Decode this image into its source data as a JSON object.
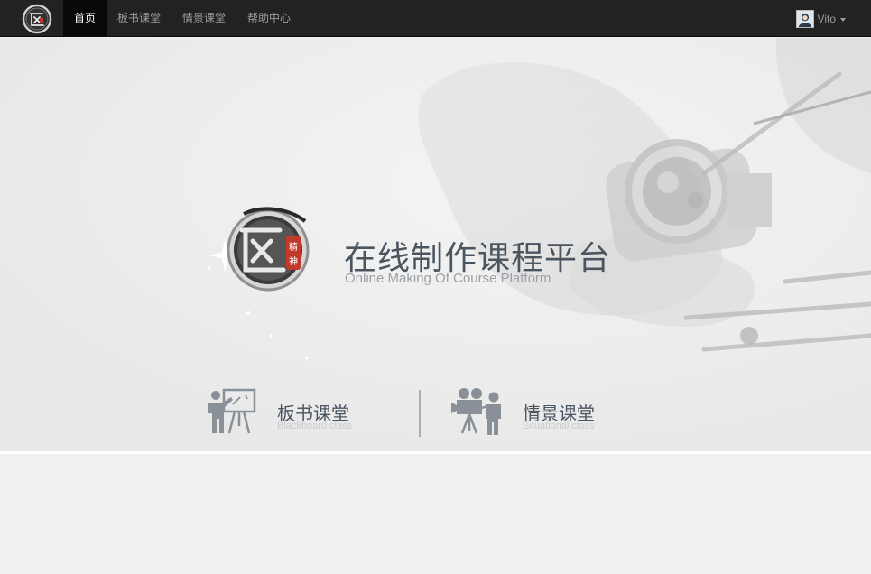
{
  "nav": {
    "items": [
      {
        "label": "首页",
        "active": true
      },
      {
        "label": "板书课堂",
        "active": false
      },
      {
        "label": "情景课堂",
        "active": false
      },
      {
        "label": "帮助中心",
        "active": false
      }
    ],
    "user_name": "Vito",
    "logo_icon": "craftsman-seal-logo",
    "avatar_icon": "user-avatar",
    "caret_icon": "caret-down-icon"
  },
  "hero": {
    "title": "在线制作课程平台",
    "subtitle": "Online Making Of Course Platform",
    "emblem_icon": "craftsman-spirit-emblem",
    "emblem_seal_text": "精神",
    "background": "watchmaker-hands-photo"
  },
  "courses": [
    {
      "title": "板书课堂",
      "subtitle": "Blackboard class",
      "icon": "teacher-blackboard-icon"
    },
    {
      "title": "情景课堂",
      "subtitle": "Situational class",
      "icon": "video-camera-operator-icon"
    }
  ],
  "colors": {
    "navbar_bg": "#222222",
    "nav_active_bg": "#080808",
    "nav_text": "#9d9d9d",
    "hero_title": "#4b5560",
    "icon_gray": "#8a9097",
    "seal_red": "#c0392b"
  }
}
